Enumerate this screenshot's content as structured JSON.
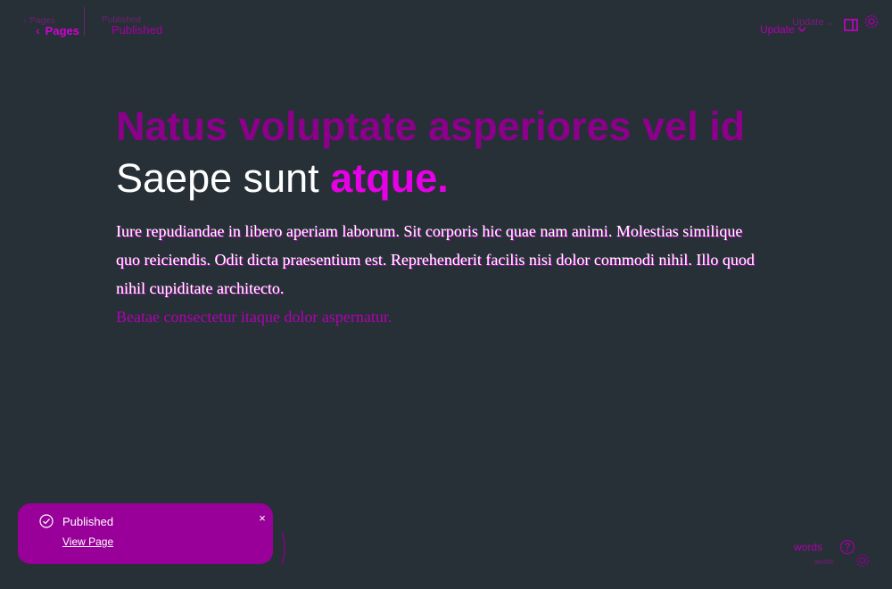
{
  "header": {
    "back_label": "Pages",
    "status": "Published",
    "update_label": "Update",
    "ghost_back_label": "Pages",
    "ghost_status": "Published",
    "ghost_update_label": "Update"
  },
  "post": {
    "title_line1": "Natus voluptate asperiores vel id",
    "title_front_white": "Saepe sunt",
    "title_front_pink": "atque.",
    "paragraph_front": "Iure repudiandae in libero aperiam laborum. Sit corporis hic quae nam animi. Molestias similique quo reiciendis. Odit dicta praesentium est. Reprehenderit facilis nisi dolor commodi nihil. Illo quod nihil cupiditate architecto.",
    "paragraph_ghost_tail": "Beatae consectetur itaque dolor aspernatur."
  },
  "toast": {
    "title": "Published",
    "link": "View Page"
  },
  "footer": {
    "words_label": "words",
    "words_ghost_label": "words"
  },
  "colors": {
    "background": "#263036",
    "accent": "#e600e6",
    "toast": "#990099"
  }
}
